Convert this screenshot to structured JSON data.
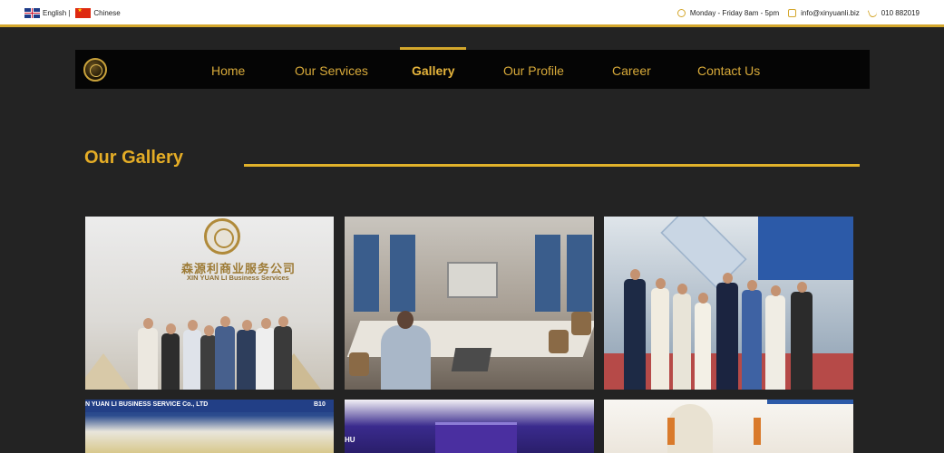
{
  "topbar": {
    "lang_english": "English",
    "lang_separator": "|",
    "lang_chinese": "Chinese",
    "hours": "Monday - Friday 8am - 5pm",
    "email": "info@xinyuanli.biz",
    "phone": "010 882019"
  },
  "nav": {
    "items": [
      "Home",
      "Our Services",
      "Gallery",
      "Our Profile",
      "Career",
      "Contact Us"
    ],
    "active": "Gallery"
  },
  "gallery": {
    "title": "Our Gallery",
    "photo1": {
      "sign_cn": "森源利商业服务公司",
      "sign_en": "XIN YUAN LI Business Services"
    },
    "photo4": {
      "banner": "N YUAN LI BUSINESS SERVICE Co., LTD",
      "code": "B10"
    },
    "photo5": {
      "banner": "HU"
    }
  },
  "colors": {
    "accent": "#d4a72c",
    "background": "#232323",
    "nav_bg": "#050505"
  }
}
